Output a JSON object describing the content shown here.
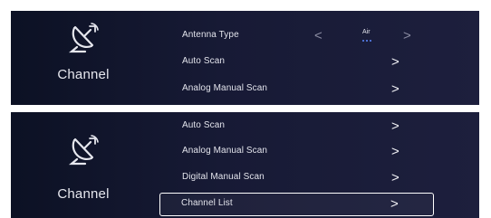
{
  "top_panel": {
    "section_title": "Channel",
    "section_icon": "satellite-dish-icon",
    "rows": [
      {
        "label": "Antenna Type",
        "value": "Air",
        "option_count": 3,
        "left_arrow": "<",
        "right_arrow": ">"
      },
      {
        "label": "Auto Scan",
        "arrow": ">"
      },
      {
        "label": "Analog Manual Scan",
        "arrow": ">"
      }
    ]
  },
  "bottom_panel": {
    "section_title": "Channel",
    "section_icon": "satellite-dish-icon",
    "rows": [
      {
        "label": "Auto Scan",
        "arrow": ">"
      },
      {
        "label": "Analog Manual Scan",
        "arrow": ">"
      },
      {
        "label": "Digital Manual Scan",
        "arrow": ">"
      },
      {
        "label": "Channel List",
        "arrow": ">",
        "selected": true
      }
    ]
  },
  "colors": {
    "panel_bg_dark": "#0c1124",
    "panel_bg_light": "#1d1f3d",
    "text": "#e3e4ec",
    "accent_dots": "#5c88ff",
    "selection_border": "#ffffff"
  }
}
